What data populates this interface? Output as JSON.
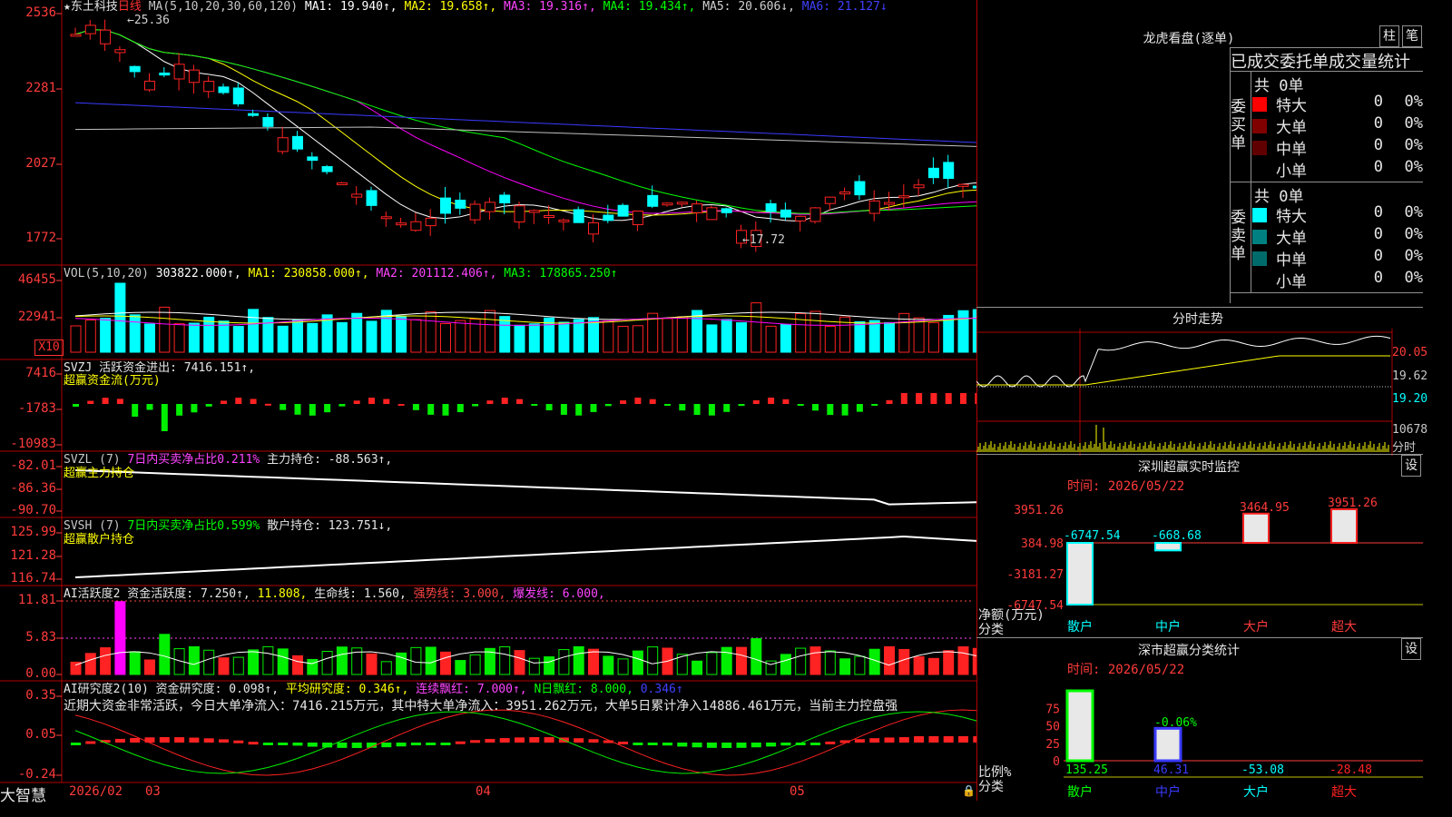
{
  "stock": {
    "star": "★",
    "name": "东土科技",
    "period": "日线"
  },
  "colors": {
    "up": "#ff2222",
    "down": "#00ffff",
    "bg": "#000000",
    "grid": "#b00000",
    "axis": "#ff3b3b",
    "ma1": "#ffffff",
    "ma2": "#ffff00",
    "ma3": "#ff00ff",
    "ma4": "#00ff00",
    "ma5": "#c0c0c0",
    "ma6": "#3a3aff",
    "green_bar": "#00ee00"
  },
  "price_panel": {
    "header": [
      {
        "t": "MA(5,10,20,30,60,120)",
        "c": "#c8c8c8"
      },
      {
        "t": "MA1: 19.940↑,",
        "c": "#ffffff"
      },
      {
        "t": "MA2: 19.658↑,",
        "c": "#ffff00"
      },
      {
        "t": "MA3: 19.316↑,",
        "c": "#ff44ff"
      },
      {
        "t": "MA4: 19.434↑,",
        "c": "#00ff00"
      },
      {
        "t": "MA5: 20.606↓,",
        "c": "#d0d0d0"
      },
      {
        "t": "MA6: 21.127↓",
        "c": "#4040ff"
      }
    ],
    "y_ticks": [
      "2536",
      "2281",
      "2027",
      "1772"
    ],
    "high_label": "25.36",
    "low_label": "17.72"
  },
  "vol_panel": {
    "header": [
      {
        "t": "VOL(5,10,20)",
        "c": "#c8c8c8"
      },
      {
        "t": "303822.000↑,",
        "c": "#ffffff"
      },
      {
        "t": "MA1: 230858.000↑,",
        "c": "#ffff00"
      },
      {
        "t": "MA2: 201112.406↑,",
        "c": "#ff44ff"
      },
      {
        "t": "MA3: 178865.250↑",
        "c": "#00ff00"
      }
    ],
    "y_ticks": [
      "46455",
      "22941"
    ],
    "unit": "X10"
  },
  "svzj_panel": {
    "header": [
      {
        "t": "SVZJ  活跃资金进出: 7416.151↑,",
        "c": "#e6e6e6"
      }
    ],
    "subtitle": "超赢资金流(万元)",
    "y_ticks": [
      "7416",
      "-1783",
      "-10983"
    ]
  },
  "svzl_panel": {
    "header": [
      {
        "t": "SVZL (7)",
        "c": "#c8c8c8"
      },
      {
        "t": "7日内买卖净占比0.211%",
        "c": "#ff44ff"
      },
      {
        "t": "主力持仓: -88.563↑,",
        "c": "#e6e6e6"
      }
    ],
    "subtitle": "超赢主力持仓",
    "y_ticks": [
      "-82.01",
      "-86.36",
      "-90.70"
    ]
  },
  "svsh_panel": {
    "header": [
      {
        "t": "SVSH (7)",
        "c": "#c8c8c8"
      },
      {
        "t": "7日内买卖净占比0.599%",
        "c": "#00ff00"
      },
      {
        "t": "散户持仓: 123.751↓,",
        "c": "#e6e6e6"
      }
    ],
    "subtitle": "超赢散户持仓",
    "y_ticks": [
      "125.99",
      "121.28",
      "116.74"
    ]
  },
  "ai_active_panel": {
    "header": [
      {
        "t": "AI活跃度2 资金活跃度: 7.250↑,",
        "c": "#e6e6e6"
      },
      {
        "t": "11.808,",
        "c": "#ffff00"
      },
      {
        "t": "生命线: 1.560,",
        "c": "#e6e6e6"
      },
      {
        "t": "强势线: 3.000,",
        "c": "#ff4444"
      },
      {
        "t": "爆发线: 6.000,",
        "c": "#ff44ff"
      }
    ],
    "y_ticks": [
      "11.81",
      "5.83",
      "0.00"
    ]
  },
  "ai_research_panel": {
    "header": [
      {
        "t": "AI研究度2(10) 资金研究度: 0.098↑,",
        "c": "#e6e6e6"
      },
      {
        "t": "平均研究度: 0.346↑,",
        "c": "#ffff00"
      },
      {
        "t": "连续飘红: 7.000↑,",
        "c": "#ff44ff"
      },
      {
        "t": "N日飘红: 8.000,",
        "c": "#00ff00"
      },
      {
        "t": "0.346↑",
        "c": "#4040ff"
      }
    ],
    "comment": "近期大资金非常活跃，今日大单净流入：7416.215万元，其中特大单净流入：3951.262万元，大单5日累计净入14886.461万元，当前主力控盘强",
    "y_ticks": [
      "0.35",
      "0.05",
      "-0.24"
    ]
  },
  "x_axis": {
    "brand": "大智慧",
    "labels": [
      "2026/02",
      "03",
      "04",
      "05"
    ]
  },
  "right": {
    "longhu_title": "龙虎看盘(逐单)",
    "btn_bar": "柱",
    "btn_pen": "笔",
    "stats_title": "已成交委托单成交量统计",
    "buy": {
      "side": "委买单",
      "total": "共 0单",
      "rows": [
        {
          "name": "特大",
          "v": "0",
          "p": "0%",
          "c": "#ff0000"
        },
        {
          "name": "大单",
          "v": "0",
          "p": "0%",
          "c": "#800000"
        },
        {
          "name": "中单",
          "v": "0",
          "p": "0%",
          "c": "#600000"
        },
        {
          "name": "小单",
          "v": "0",
          "p": "0%",
          "c": "#000000"
        }
      ]
    },
    "sell": {
      "side": "委卖单",
      "total": "共 0单",
      "rows": [
        {
          "name": "特大",
          "v": "0",
          "p": "0%",
          "c": "#00ffff"
        },
        {
          "name": "大单",
          "v": "0",
          "p": "0%",
          "c": "#008080"
        },
        {
          "name": "中单",
          "v": "0",
          "p": "0%",
          "c": "#006b6b"
        },
        {
          "name": "小单",
          "v": "0",
          "p": "0%",
          "c": "#000000"
        }
      ]
    },
    "intraday": {
      "title": "分时走势",
      "y_ticks": [
        "20.05",
        "19.62",
        "19.20"
      ],
      "vol_tick": "10678",
      "vol_label": "分时"
    },
    "monitor": {
      "title": "深圳超赢实时监控",
      "btn": "设",
      "time": "时间: 2026/05/22",
      "y_ticks": [
        "3951.26",
        "384.98",
        "-3181.27",
        "-6747.54"
      ],
      "unit": "净额(万元)",
      "cat_label": "分类",
      "bars": [
        {
          "cat": "散户",
          "value": -6747.54,
          "label": "-6747.54"
        },
        {
          "cat": "中户",
          "value": -668.68,
          "label": "-668.68"
        },
        {
          "cat": "大户",
          "value": 3464.95,
          "label": "3464.95"
        },
        {
          "cat": "超大",
          "value": 3951.26,
          "label": "3951.26"
        }
      ]
    },
    "classify": {
      "title": "深市超赢分类统计",
      "btn": "设",
      "time": "时间: 2026/05/22",
      "y_ticks": [
        "75",
        "50",
        "25",
        "0"
      ],
      "unit": "比例%",
      "cat_label": "分类",
      "bars": [
        {
          "cat": "散户",
          "value": 135.25,
          "label": "135.25"
        },
        {
          "cat": "中户",
          "value": 46.31,
          "label": "46.31"
        },
        {
          "cat": "大户",
          "value": -53.08,
          "label": "-53.08"
        },
        {
          "cat": "超大",
          "value": -28.48,
          "label": "-28.48"
        }
      ],
      "extra_label": "-0.06%"
    }
  }
}
